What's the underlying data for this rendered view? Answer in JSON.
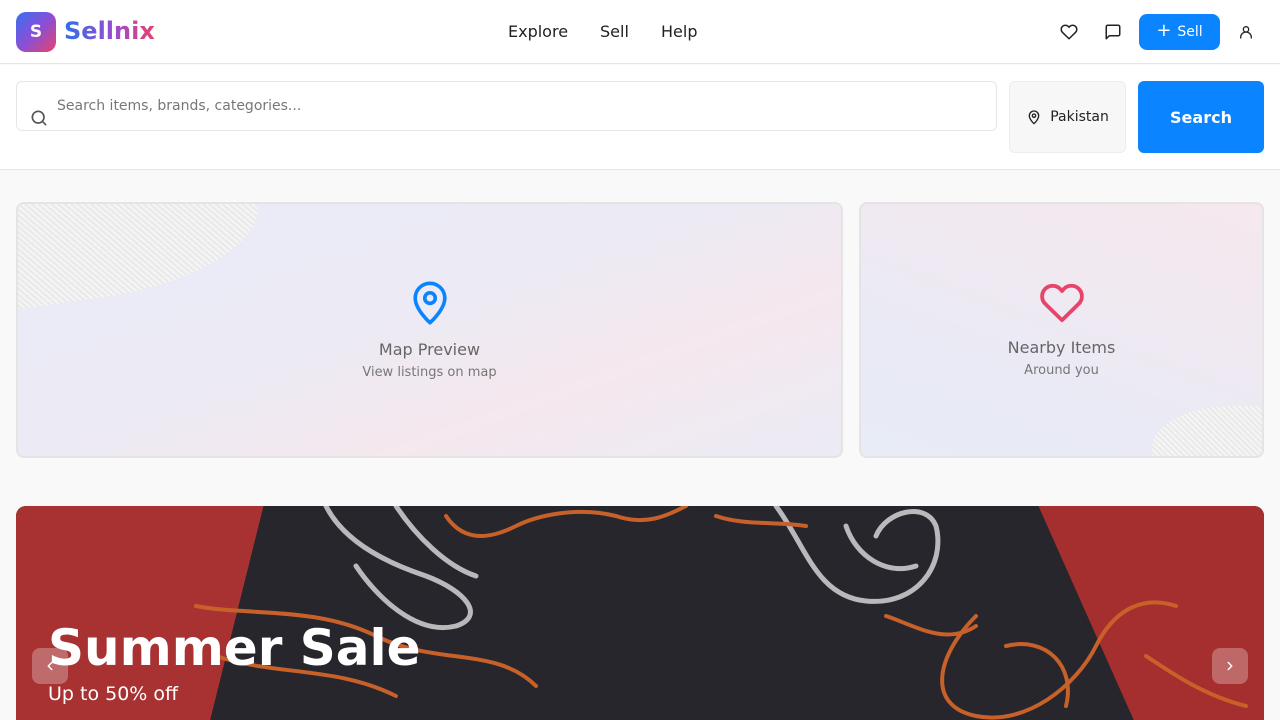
{
  "brand": {
    "initial": "S",
    "name": "Sellnix"
  },
  "nav": {
    "explore": "Explore",
    "sell": "Sell",
    "help": "Help"
  },
  "header_actions": {
    "sell_button_label": "Sell",
    "icons": [
      "heart-icon",
      "message-icon",
      "plus-icon",
      "user-icon"
    ]
  },
  "search": {
    "placeholder": "Search items, brands, categories...",
    "value": "",
    "location": "Pakistan",
    "button_label": "Search"
  },
  "cards": {
    "map": {
      "title": "Map Preview",
      "subtitle": "View listings on map",
      "icon": "map-pin-icon"
    },
    "nearby": {
      "title": "Nearby Items",
      "subtitle": "Around you",
      "icon": "heart-icon"
    }
  },
  "banner": {
    "title": "Summer Sale",
    "subtitle": "Up to 50% off"
  },
  "colors": {
    "primary": "#0a84ff",
    "accent_red": "#e8436a",
    "brand_blue": "#2f6fe8",
    "brand_purple": "#9a4bd0"
  }
}
